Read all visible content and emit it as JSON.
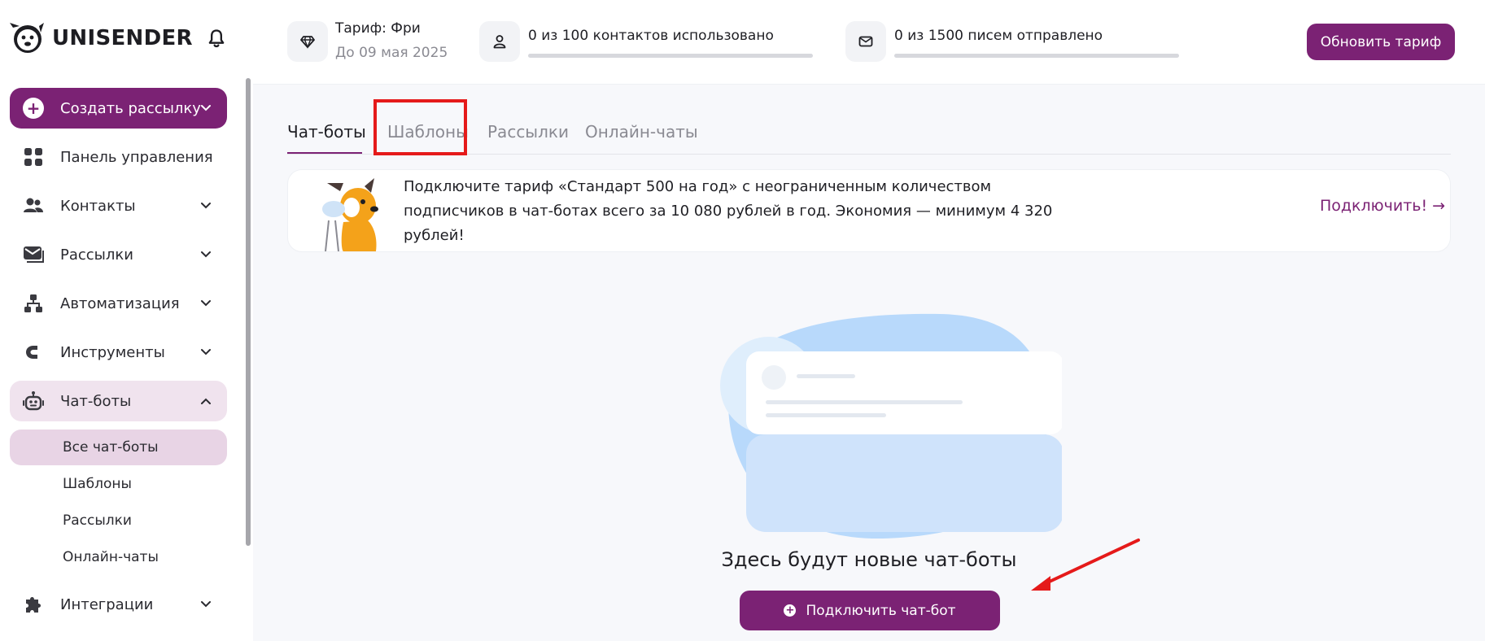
{
  "app": {
    "logo_text": "UNISENDER"
  },
  "sidebar": {
    "create_button": "Создать рассылку",
    "items": [
      {
        "label": "Панель управления",
        "icon": "dashboard-icon",
        "chevron": false
      },
      {
        "label": "Контакты",
        "icon": "contacts-icon",
        "chevron": true
      },
      {
        "label": "Рассылки",
        "icon": "mail-icon",
        "chevron": true
      },
      {
        "label": "Автоматизация",
        "icon": "automation-icon",
        "chevron": true
      },
      {
        "label": "Инструменты",
        "icon": "tools-icon",
        "chevron": true
      },
      {
        "label": "Чат-боты",
        "icon": "bot-icon",
        "chevron": true,
        "expanded": true
      },
      {
        "label": "Интеграции",
        "icon": "puzzle-icon",
        "chevron": true
      }
    ],
    "chatbots_submenu": [
      {
        "label": "Все чат-боты",
        "active": true
      },
      {
        "label": "Шаблоны"
      },
      {
        "label": "Рассылки"
      },
      {
        "label": "Онлайн-чаты"
      }
    ]
  },
  "topbar": {
    "plan_title": "Тариф: Фри",
    "plan_until": "До 09 мая 2025",
    "contacts_usage": "0 из 100 контактов использовано",
    "contacts_used_fraction": 0,
    "emails_usage": "0 из 1500 писем отправлено",
    "emails_used_fraction": 0,
    "upgrade_button": "Обновить тариф"
  },
  "main": {
    "tabs": [
      {
        "label": "Чат-боты",
        "active": true
      },
      {
        "label": "Шаблоны",
        "highlighted": true
      },
      {
        "label": "Рассылки"
      },
      {
        "label": "Онлайн-чаты"
      }
    ],
    "promo": {
      "text": "Подключите тариф «Стандарт 500 на год» с неограниченным количеством подписчиков в чат-ботах всего за 10 080 рублей в год. Экономия — минимум 4 320 рублей!",
      "link": "Подключить! →"
    },
    "empty_state": {
      "title": "Здесь будут новые чат-боты",
      "button": "Подключить чат-бот"
    }
  },
  "colors": {
    "brand": "#7b2274",
    "active_bg": "#f0e3ee",
    "highlight_red": "#e51a1a"
  }
}
